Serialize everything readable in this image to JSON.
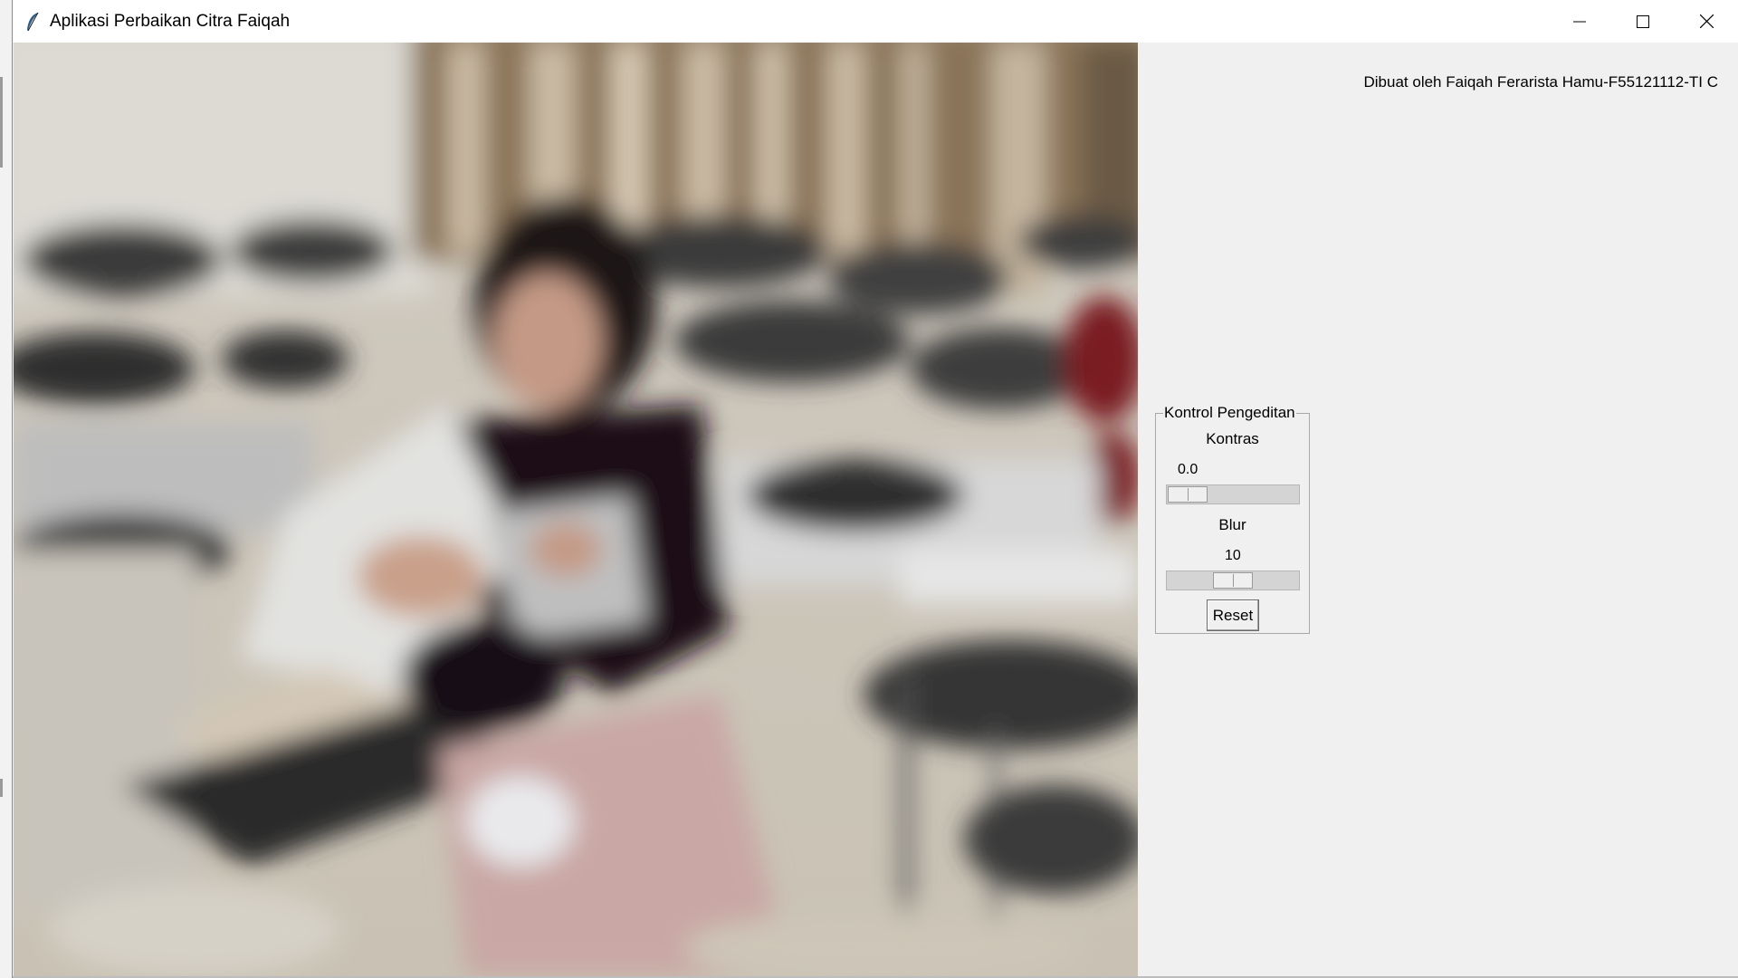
{
  "window": {
    "title": "Aplikasi Perbaikan Citra Faiqah",
    "icon": "feather-icon",
    "controls": [
      "minimize-icon",
      "maximize-icon",
      "close-icon"
    ]
  },
  "credit": "Dibuat oleh Faiqah Ferarista Hamu-F55121112-TI C",
  "panel": {
    "legend": "Kontrol Pengeditan",
    "contrast": {
      "label": "Kontras",
      "value": "0.0",
      "level": 0.0
    },
    "blur": {
      "label": "Blur",
      "value": "10",
      "level": 0.5
    },
    "reset_label": "Reset"
  },
  "colors": {
    "window_bg": "#f0f0f0",
    "titlebar_bg": "#ffffff",
    "trough": "#d4d4d4"
  }
}
